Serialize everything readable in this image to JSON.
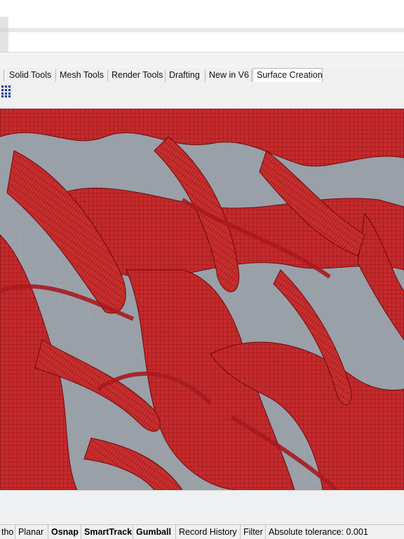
{
  "ribbon": {
    "tabs": [
      {
        "label": "Solid Tools"
      },
      {
        "label": "Mesh Tools"
      },
      {
        "label": "Render Tools"
      },
      {
        "label": "Drafting"
      },
      {
        "label": "New in V6"
      },
      {
        "label": "Surface Creation",
        "active": true
      }
    ]
  },
  "toolbar": {
    "icon": "grid-tool-icon"
  },
  "viewport": {
    "content": "wireframe-mesh",
    "mesh_color": "#b81c22",
    "background": "#9aa0a8"
  },
  "statusbar": {
    "ortho": "tho",
    "planar": "Planar",
    "osnap": "Osnap",
    "smarttrack": "SmartTrack",
    "gumball": "Gumball",
    "record_history": "Record History",
    "filter": "Filter",
    "tolerance": "Absolute tolerance: 0.001"
  }
}
